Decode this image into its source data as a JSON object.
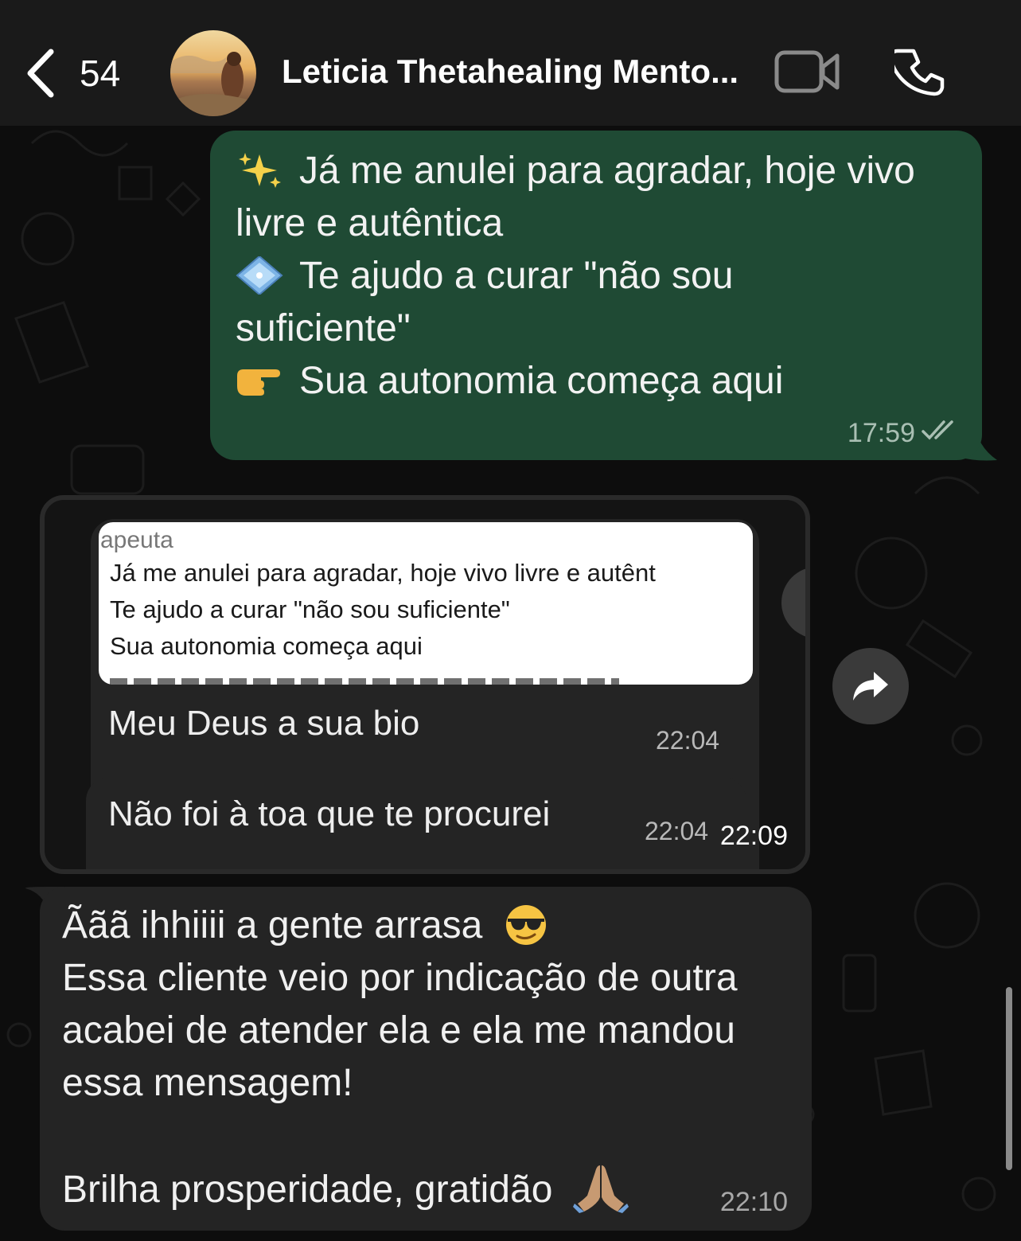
{
  "header": {
    "back_count": "54",
    "contact_name": "Leticia Thetahealing Mento..."
  },
  "outgoing": {
    "lines": [
      "Já me anulei para agradar, hoje vivo",
      "livre e autêntica",
      "Te ajudo a curar \"não sou",
      "suficiente\"",
      "Sua autonomia começa aqui"
    ],
    "emoji_icons": [
      "sparkles-icon",
      "diamond-icon",
      "pointing-hand-icon"
    ],
    "time": "17:59",
    "status_icon": "double-check-icon"
  },
  "forwarded_screenshot": {
    "quoted_sender": "apeuta",
    "quoted_lines": [
      "Já me anulei para agradar, hoje vivo livre e autênt",
      "Te ajudo a curar \"não sou suficiente\"",
      "Sua autonomia começa aqui"
    ],
    "message1": {
      "text": "Meu Deus a sua bio",
      "time": "22:04"
    },
    "message2": {
      "text": "Não foi à toa que te procurei",
      "time": "22:04"
    },
    "time": "22:09"
  },
  "incoming": {
    "lines": [
      "Ããã ihhiiii a gente arrasa",
      "Essa cliente veio por indicação de outra",
      "acabei de atender ela e ela me mandou",
      "essa mensagem!",
      "",
      "Brilha prosperidade, gratidão"
    ],
    "emoji_icons": [
      "sunglasses-face-icon",
      "praying-hands-icon"
    ],
    "time": "22:10"
  },
  "colors": {
    "header_bg": "#1a1a1a",
    "outgoing_bubble": "#1f4a34",
    "incoming_bubble": "#242424",
    "background": "#0c0c0c"
  }
}
